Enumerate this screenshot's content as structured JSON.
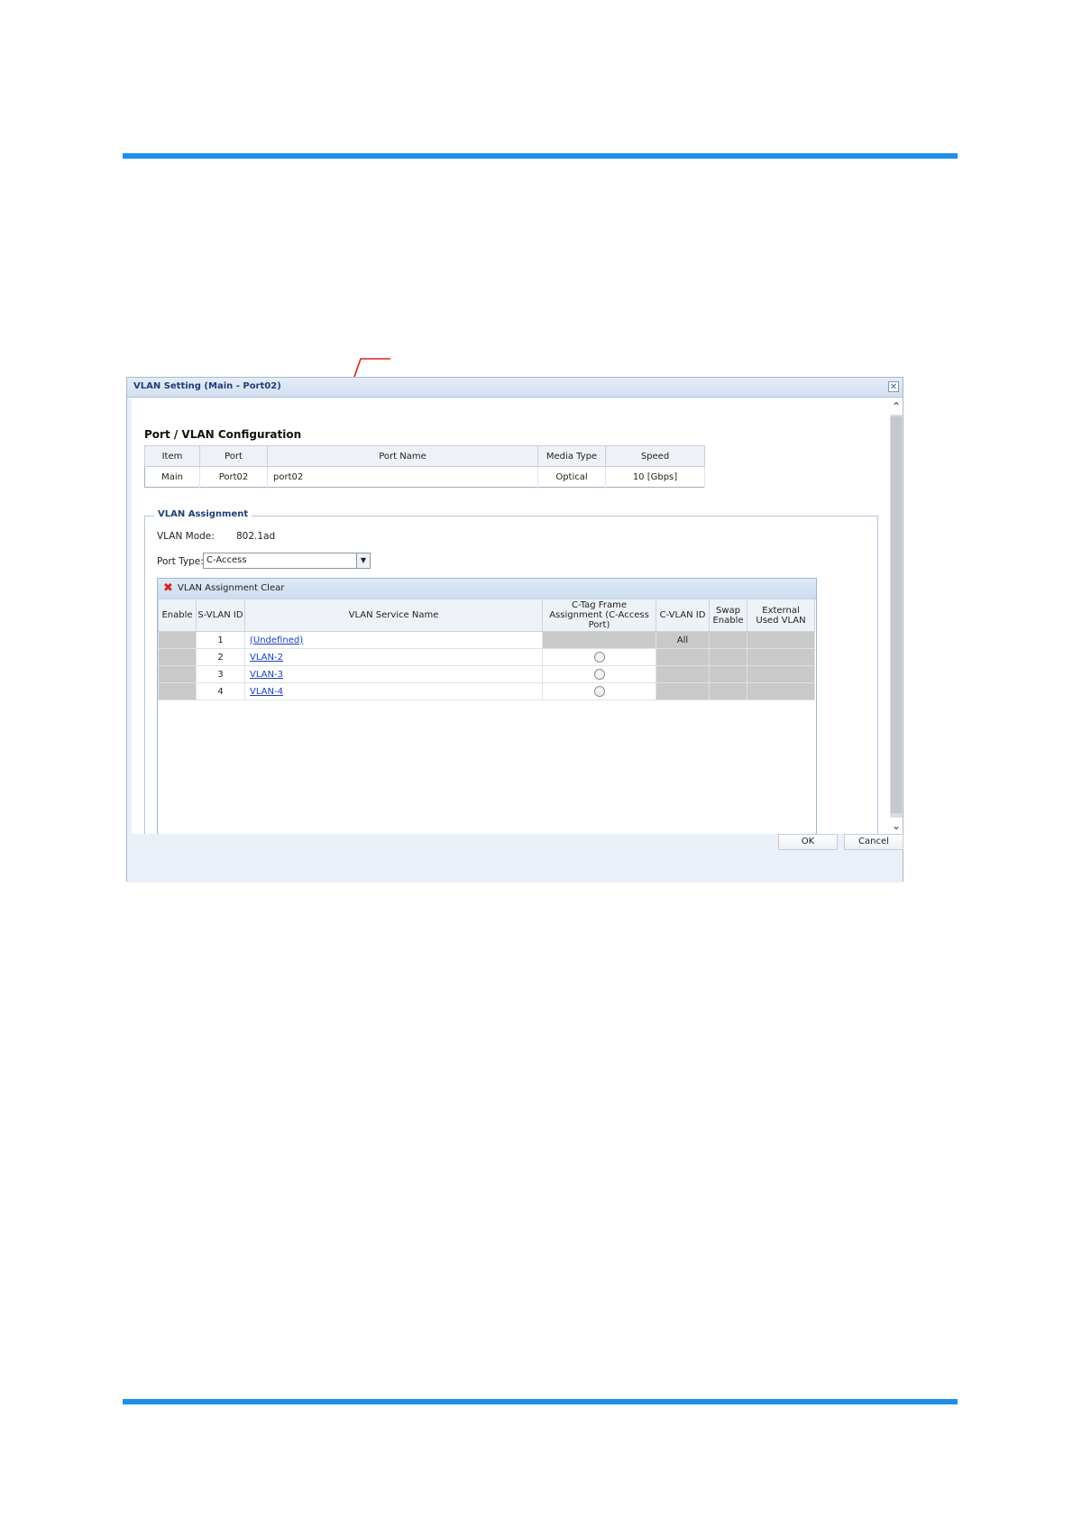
{
  "dialog": {
    "title": "VLAN Setting (Main - Port02)",
    "close_icon": "close-icon"
  },
  "port_config": {
    "heading": "Port / VLAN Configuration",
    "columns": [
      "Item",
      "Port",
      "Port Name",
      "Media Type",
      "Speed"
    ],
    "row": {
      "item": "Main",
      "port": "Port02",
      "port_name": "port02",
      "media_type": "Optical",
      "speed": "10 [Gbps]"
    }
  },
  "vlan_assignment": {
    "legend": "VLAN Assignment",
    "mode_label": "VLAN Mode:",
    "mode_value": "802.1ad",
    "port_type_label": "Port Type:",
    "port_type_value": "C-Access",
    "clear_label": "VLAN Assignment Clear",
    "columns": {
      "enable": "Enable",
      "svlan_id": "S-VLAN ID",
      "service_name": "VLAN Service Name",
      "ctag_line1": "C-Tag Frame",
      "ctag_line2": "Assignment (C-Access Port)",
      "cvlan_id": "C-VLAN ID",
      "swap_line1": "Swap",
      "swap_line2": "Enable",
      "ext_line1": "External",
      "ext_line2": "Used VLAN"
    },
    "rows": [
      {
        "svlan_id": "1",
        "name": "(Undefined)",
        "cvlan_id": "All"
      },
      {
        "svlan_id": "2",
        "name": "VLAN-2",
        "cvlan_id": ""
      },
      {
        "svlan_id": "3",
        "name": "VLAN-3",
        "cvlan_id": ""
      },
      {
        "svlan_id": "4",
        "name": "VLAN-4",
        "cvlan_id": ""
      }
    ]
  },
  "buttons": {
    "ok": "OK",
    "cancel": "Cancel"
  },
  "colors": {
    "rule": "#1e90e8",
    "callout": "#e02020",
    "link": "#1a3ec8"
  }
}
